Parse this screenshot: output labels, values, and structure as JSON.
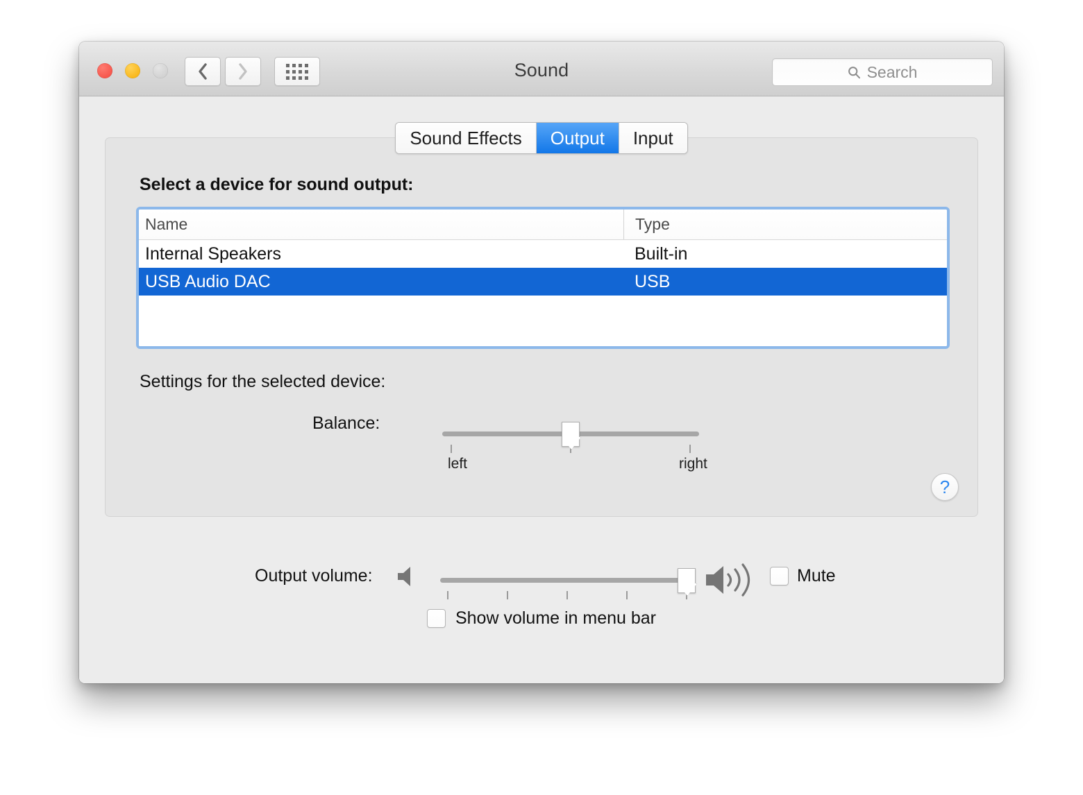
{
  "window": {
    "title": "Sound",
    "traffic_lights": [
      "close",
      "minimize",
      "zoom"
    ],
    "nav": {
      "back": "back-chevron",
      "forward": "forward-chevron",
      "show_all": "grid-icon"
    },
    "search": {
      "placeholder": "Search",
      "value": "",
      "icon": "search-icon"
    }
  },
  "tabs": [
    {
      "label": "Sound Effects",
      "active": false
    },
    {
      "label": "Output",
      "active": true
    },
    {
      "label": "Input",
      "active": false
    }
  ],
  "panel": {
    "device_heading": "Select a device for sound output:",
    "table": {
      "columns": [
        "Name",
        "Type"
      ],
      "rows": [
        {
          "name": "Internal Speakers",
          "type": "Built-in",
          "selected": false
        },
        {
          "name": "USB Audio DAC",
          "type": "USB",
          "selected": true
        }
      ]
    },
    "settings_heading": "Settings for the selected device:",
    "balance": {
      "label": "Balance:",
      "left_label": "left",
      "right_label": "right",
      "value_percent": 50
    },
    "help": {
      "label": "?",
      "icon": "help-icon"
    }
  },
  "volume": {
    "label": "Output volume:",
    "value_percent": 96,
    "low_icon": "speaker-quiet-icon",
    "high_icon": "speaker-loud-icon",
    "mute": {
      "label": "Mute",
      "checked": false
    },
    "show_in_menu_bar": {
      "label": "Show volume in menu bar",
      "checked": false
    }
  },
  "colors": {
    "selection_blue": "#1266d4",
    "tab_active_blue": "#1277e8",
    "focus_ring": "#8cb8ea",
    "help_blue": "#2d87ef",
    "window_bg": "#ececec",
    "panel_bg": "#e4e4e4"
  }
}
